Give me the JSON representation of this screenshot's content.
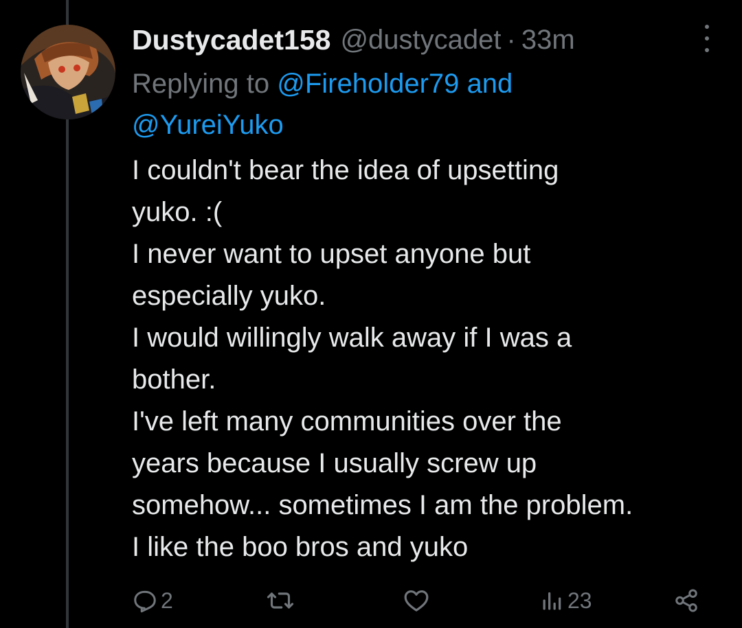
{
  "tweet": {
    "display_name": "Dustycadet158",
    "handle": "@dustycadet",
    "separator": "·",
    "time": "33m",
    "reply_prefix": "Replying to",
    "reply_mention_1": "@Fireholder79",
    "reply_and": "and",
    "reply_mention_2": "@YureiYuko",
    "text_lines": [
      "I couldn't bear the idea of upsetting",
      "yuko. :(",
      "I never want to upset anyone but",
      "especially yuko.",
      "I would willingly walk away if I was a",
      "bother.",
      "I've left many communities over the",
      "years because I usually screw up",
      "somehow... sometimes I am the problem.",
      "I like the boo bros and yuko"
    ]
  },
  "actions": {
    "reply_count": "2",
    "retweet_count": "",
    "like_count": "",
    "views_count": "23"
  },
  "icons": {
    "more": "more-vertical-icon",
    "reply": "reply-icon",
    "retweet": "retweet-icon",
    "like": "heart-icon",
    "views": "views-icon",
    "share": "share-icon"
  },
  "colors": {
    "background": "#000000",
    "text": "#e7e9ea",
    "muted": "#71767b",
    "accent": "#1d9bf0",
    "thread_line": "#333639"
  }
}
